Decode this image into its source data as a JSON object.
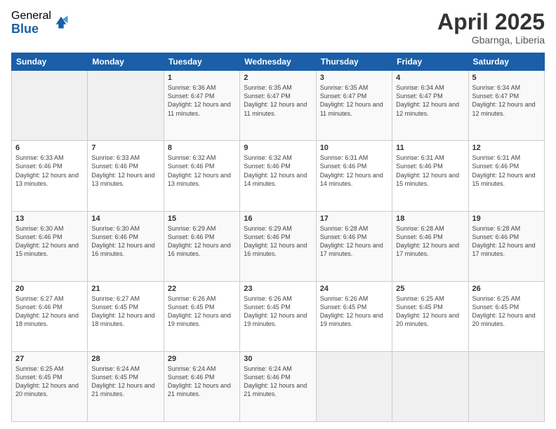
{
  "logo": {
    "general": "General",
    "blue": "Blue"
  },
  "title": {
    "month": "April 2025",
    "location": "Gbarnga, Liberia"
  },
  "weekdays": [
    "Sunday",
    "Monday",
    "Tuesday",
    "Wednesday",
    "Thursday",
    "Friday",
    "Saturday"
  ],
  "weeks": [
    [
      {
        "day": "",
        "info": ""
      },
      {
        "day": "",
        "info": ""
      },
      {
        "day": "1",
        "info": "Sunrise: 6:36 AM\nSunset: 6:47 PM\nDaylight: 12 hours and 11 minutes."
      },
      {
        "day": "2",
        "info": "Sunrise: 6:35 AM\nSunset: 6:47 PM\nDaylight: 12 hours and 11 minutes."
      },
      {
        "day": "3",
        "info": "Sunrise: 6:35 AM\nSunset: 6:47 PM\nDaylight: 12 hours and 11 minutes."
      },
      {
        "day": "4",
        "info": "Sunrise: 6:34 AM\nSunset: 6:47 PM\nDaylight: 12 hours and 12 minutes."
      },
      {
        "day": "5",
        "info": "Sunrise: 6:34 AM\nSunset: 6:47 PM\nDaylight: 12 hours and 12 minutes."
      }
    ],
    [
      {
        "day": "6",
        "info": "Sunrise: 6:33 AM\nSunset: 6:46 PM\nDaylight: 12 hours and 13 minutes."
      },
      {
        "day": "7",
        "info": "Sunrise: 6:33 AM\nSunset: 6:46 PM\nDaylight: 12 hours and 13 minutes."
      },
      {
        "day": "8",
        "info": "Sunrise: 6:32 AM\nSunset: 6:46 PM\nDaylight: 12 hours and 13 minutes."
      },
      {
        "day": "9",
        "info": "Sunrise: 6:32 AM\nSunset: 6:46 PM\nDaylight: 12 hours and 14 minutes."
      },
      {
        "day": "10",
        "info": "Sunrise: 6:31 AM\nSunset: 6:46 PM\nDaylight: 12 hours and 14 minutes."
      },
      {
        "day": "11",
        "info": "Sunrise: 6:31 AM\nSunset: 6:46 PM\nDaylight: 12 hours and 15 minutes."
      },
      {
        "day": "12",
        "info": "Sunrise: 6:31 AM\nSunset: 6:46 PM\nDaylight: 12 hours and 15 minutes."
      }
    ],
    [
      {
        "day": "13",
        "info": "Sunrise: 6:30 AM\nSunset: 6:46 PM\nDaylight: 12 hours and 15 minutes."
      },
      {
        "day": "14",
        "info": "Sunrise: 6:30 AM\nSunset: 6:46 PM\nDaylight: 12 hours and 16 minutes."
      },
      {
        "day": "15",
        "info": "Sunrise: 6:29 AM\nSunset: 6:46 PM\nDaylight: 12 hours and 16 minutes."
      },
      {
        "day": "16",
        "info": "Sunrise: 6:29 AM\nSunset: 6:46 PM\nDaylight: 12 hours and 16 minutes."
      },
      {
        "day": "17",
        "info": "Sunrise: 6:28 AM\nSunset: 6:46 PM\nDaylight: 12 hours and 17 minutes."
      },
      {
        "day": "18",
        "info": "Sunrise: 6:28 AM\nSunset: 6:46 PM\nDaylight: 12 hours and 17 minutes."
      },
      {
        "day": "19",
        "info": "Sunrise: 6:28 AM\nSunset: 6:46 PM\nDaylight: 12 hours and 17 minutes."
      }
    ],
    [
      {
        "day": "20",
        "info": "Sunrise: 6:27 AM\nSunset: 6:46 PM\nDaylight: 12 hours and 18 minutes."
      },
      {
        "day": "21",
        "info": "Sunrise: 6:27 AM\nSunset: 6:45 PM\nDaylight: 12 hours and 18 minutes."
      },
      {
        "day": "22",
        "info": "Sunrise: 6:26 AM\nSunset: 6:45 PM\nDaylight: 12 hours and 19 minutes."
      },
      {
        "day": "23",
        "info": "Sunrise: 6:26 AM\nSunset: 6:45 PM\nDaylight: 12 hours and 19 minutes."
      },
      {
        "day": "24",
        "info": "Sunrise: 6:26 AM\nSunset: 6:45 PM\nDaylight: 12 hours and 19 minutes."
      },
      {
        "day": "25",
        "info": "Sunrise: 6:25 AM\nSunset: 6:45 PM\nDaylight: 12 hours and 20 minutes."
      },
      {
        "day": "26",
        "info": "Sunrise: 6:25 AM\nSunset: 6:45 PM\nDaylight: 12 hours and 20 minutes."
      }
    ],
    [
      {
        "day": "27",
        "info": "Sunrise: 6:25 AM\nSunset: 6:45 PM\nDaylight: 12 hours and 20 minutes."
      },
      {
        "day": "28",
        "info": "Sunrise: 6:24 AM\nSunset: 6:45 PM\nDaylight: 12 hours and 21 minutes."
      },
      {
        "day": "29",
        "info": "Sunrise: 6:24 AM\nSunset: 6:46 PM\nDaylight: 12 hours and 21 minutes."
      },
      {
        "day": "30",
        "info": "Sunrise: 6:24 AM\nSunset: 6:46 PM\nDaylight: 12 hours and 21 minutes."
      },
      {
        "day": "",
        "info": ""
      },
      {
        "day": "",
        "info": ""
      },
      {
        "day": "",
        "info": ""
      }
    ]
  ]
}
